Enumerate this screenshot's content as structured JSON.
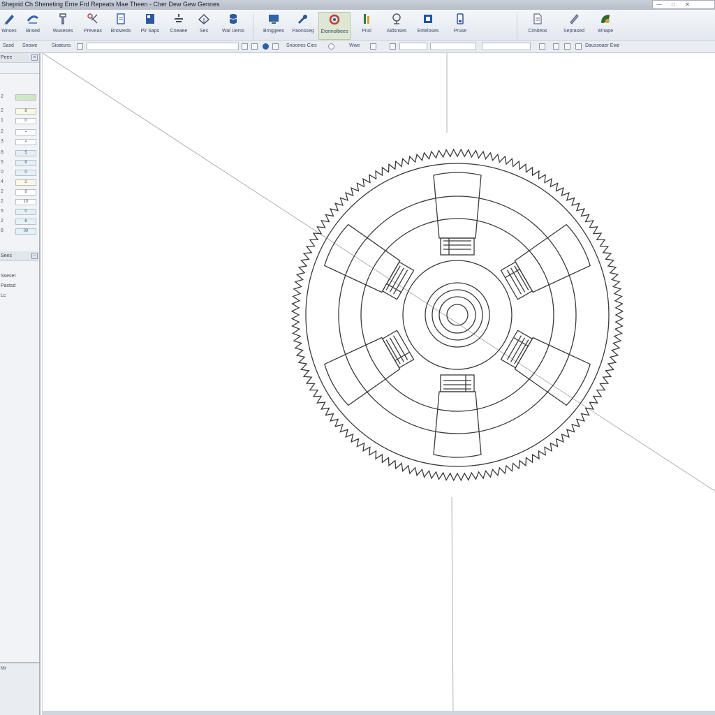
{
  "window": {
    "title": "Sheprid Ch Sheneting Erne Frd Repeats Mae Theen - Cher Dew Gew Gennes",
    "controls": [
      "—",
      "□",
      "✕"
    ]
  },
  "ribbon": {
    "buttons": [
      {
        "label": "Wnses",
        "icon": "pencil-icon",
        "color": "#2f5f9e"
      },
      {
        "label": "Bnsed",
        "icon": "curve-icon",
        "color": "#2f62b2"
      },
      {
        "label": "Wuseses",
        "icon": "tool-icon",
        "color": "#4a5c78"
      },
      {
        "label": "Preveas",
        "icon": "scissors-icon",
        "color": "#b04545"
      },
      {
        "label": "Bnoweds",
        "icon": "document-icon",
        "color": "#3b69b0"
      },
      {
        "label": "Pir Saps",
        "icon": "panel-icon",
        "color": "#2c5aa0"
      },
      {
        "label": "Cneaee",
        "icon": "align-icon",
        "color": "#3d4b63"
      },
      {
        "label": "Ses",
        "icon": "triangle-icon",
        "color": "#4a5770"
      },
      {
        "label": "Wal Uerss",
        "icon": "database-icon",
        "color": "#2e58a0"
      },
      {
        "label": "Brnggees",
        "icon": "monitor-icon",
        "color": "#2f63a8"
      },
      {
        "label": "Paonsseg",
        "icon": "tools-icon",
        "color": "#2d5697"
      },
      {
        "label": "Etonnolbees",
        "icon": "refresh-icon",
        "color": "#c43a3a"
      },
      {
        "label": "Pnsl",
        "icon": "bars-icon",
        "color": "#2f7a3a"
      },
      {
        "label": "Aidsnses",
        "icon": "globe-icon",
        "color": "#4d5a6e"
      },
      {
        "label": "Enteloses",
        "icon": "square-icon",
        "color": "#2056a8"
      },
      {
        "label": "Pruse",
        "icon": "phone-icon",
        "color": "#3a5b96"
      },
      {
        "label": "Cimiteos",
        "icon": "page-icon",
        "color": "#5a6b82"
      },
      {
        "label": "Seprased",
        "icon": "brush-icon",
        "color": "#4c5c74"
      },
      {
        "label": "Wnape",
        "icon": "leaf-icon",
        "color": "#2f6b2f"
      }
    ]
  },
  "optionbar": {
    "labels": [
      "Sasd",
      "Snowe",
      "Sioatuns",
      "Snoones Cies",
      "Wwe",
      "Daussoaer Ewe"
    ],
    "search_value": ""
  },
  "leftpanel": {
    "header": "Peee",
    "properties": [
      {
        "k": "2",
        "v": ""
      },
      {
        "k": "2",
        "v": "8"
      },
      {
        "k": "1",
        "v": "0"
      },
      {
        "k": "2",
        "v": "▪"
      },
      {
        "k": "3",
        "v": "▪"
      },
      {
        "k": "8",
        "v": "5"
      },
      {
        "k": "5",
        "v": "8"
      },
      {
        "k": "0",
        "v": "0"
      },
      {
        "k": "4",
        "v": "2"
      },
      {
        "k": "2",
        "v": "8"
      },
      {
        "k": "2",
        "v": "10"
      },
      {
        "k": "5",
        "v": "0"
      },
      {
        "k": "2",
        "v": "6"
      },
      {
        "k": "8",
        "v": "00"
      }
    ],
    "section2_header": "Sees",
    "tree": [
      "Sseset",
      "Pastsd",
      "Lc"
    ],
    "bottom_label": "Mr"
  },
  "drawing": {
    "gear_teeth": 140,
    "spoke_count": 6,
    "line_color": "#3a3a3a",
    "guide_color": "#b0b0b0"
  }
}
